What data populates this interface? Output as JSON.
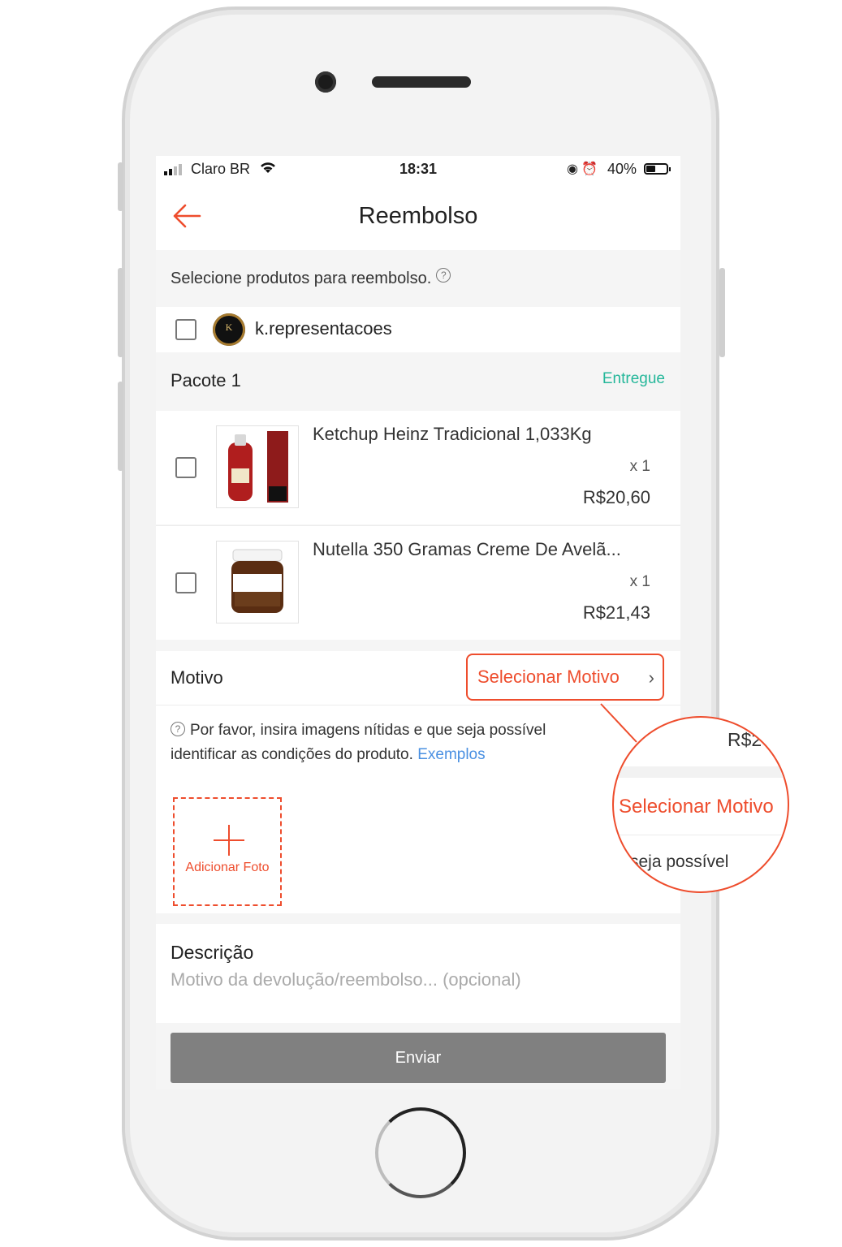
{
  "status_bar": {
    "carrier": "Claro BR",
    "time": "18:31",
    "battery": "40%"
  },
  "header": {
    "title": "Reembolso"
  },
  "select_hint": "Selecione produtos para reembolso.",
  "shop": {
    "name": "k.representacoes"
  },
  "package": {
    "title": "Pacote 1",
    "status": "Entregue"
  },
  "items": [
    {
      "name": "Ketchup Heinz Tradicional 1,033Kg",
      "qty": "x 1",
      "price": "R$20,60"
    },
    {
      "name": "Nutella 350 Gramas Creme De Avelã...",
      "qty": "x 1",
      "price": "R$21,43"
    }
  ],
  "reason": {
    "label": "Motivo",
    "select_label": "Selecionar Motivo"
  },
  "photos": {
    "hint": "Por favor, insira imagens nítidas e que seja possível identificar as condições do produto.",
    "examples_link": "Exemplos",
    "add_label": "Adicionar Foto"
  },
  "description": {
    "title": "Descrição",
    "placeholder": "Motivo da devolução/reembolso... (opcional)"
  },
  "submit_label": "Enviar",
  "zoom_callout": {
    "price_fragment": "R$2",
    "reason_text": "Selecionar Motivo",
    "hint_fragment": "seja possível"
  },
  "colors": {
    "accent": "#ee4d2d",
    "status_green": "#25b79a",
    "link_blue": "#4a90e2",
    "submit_gray": "#808080"
  },
  "icons": [
    "back-arrow-icon",
    "help-circle-icon",
    "chevron-right-icon",
    "plus-icon",
    "wifi-icon",
    "signal-icon",
    "battery-icon",
    "alarm-icon",
    "orientation-lock-icon"
  ]
}
